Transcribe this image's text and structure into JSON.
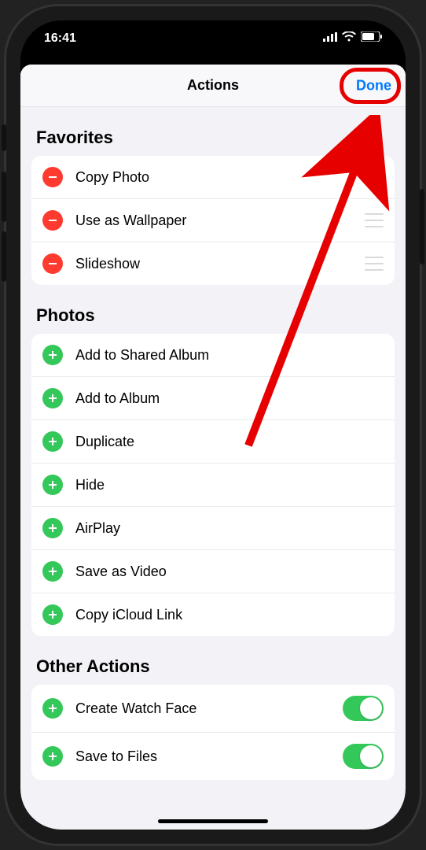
{
  "statusbar": {
    "time": "16:41"
  },
  "sheet": {
    "title": "Actions",
    "done": "Done"
  },
  "sections": {
    "favorites": {
      "header": "Favorites",
      "items": [
        {
          "label": "Copy Photo"
        },
        {
          "label": "Use as Wallpaper"
        },
        {
          "label": "Slideshow"
        }
      ]
    },
    "photos": {
      "header": "Photos",
      "items": [
        {
          "label": "Add to Shared Album"
        },
        {
          "label": "Add to Album"
        },
        {
          "label": "Duplicate"
        },
        {
          "label": "Hide"
        },
        {
          "label": "AirPlay"
        },
        {
          "label": "Save as Video"
        },
        {
          "label": "Copy iCloud Link"
        }
      ]
    },
    "other": {
      "header": "Other Actions",
      "items": [
        {
          "label": "Create Watch Face",
          "toggle": true
        },
        {
          "label": "Save to Files",
          "toggle": true
        }
      ]
    }
  }
}
